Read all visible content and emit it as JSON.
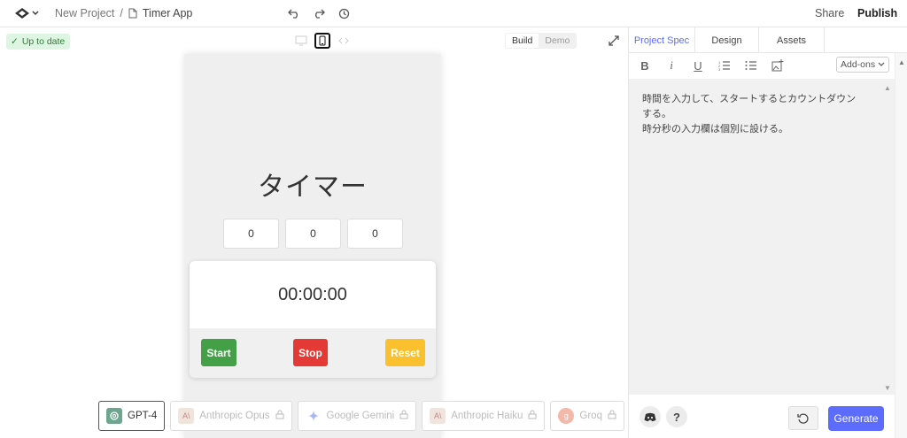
{
  "header": {
    "project_name": "New Project",
    "separator": "/",
    "file_name": "Timer App",
    "share_label": "Share",
    "publish_label": "Publish"
  },
  "canvas": {
    "status_label": "Up to date",
    "modes": [
      "Build",
      "Demo"
    ],
    "active_mode": "Build"
  },
  "preview": {
    "title": "タイマー",
    "inputs": [
      "0",
      "0",
      "0"
    ],
    "time_display": "00:00:00",
    "buttons": {
      "start": "Start",
      "stop": "Stop",
      "reset": "Reset"
    },
    "colors": {
      "start": "#43a047",
      "stop": "#e53935",
      "reset": "#fbc02d"
    }
  },
  "models": [
    {
      "label": "GPT-4",
      "icon": "openai-icon",
      "selected": true,
      "locked": false
    },
    {
      "label": "Anthropic Opus",
      "icon": "anthropic-icon",
      "selected": false,
      "locked": true
    },
    {
      "label": "Google Gemini",
      "icon": "gemini-icon",
      "selected": false,
      "locked": true
    },
    {
      "label": "Anthropic Haiku",
      "icon": "anthropic-icon",
      "selected": false,
      "locked": true
    },
    {
      "label": "Groq",
      "icon": "groq-icon",
      "selected": false,
      "locked": true
    }
  ],
  "panel": {
    "tabs": [
      "Project Spec",
      "Design",
      "Assets"
    ],
    "active_tab": "Project Spec",
    "addons_label": "Add-ons",
    "spec_lines": [
      "時間を入力して、スタートするとカウントダウン",
      "する。",
      "時分秒の入力欄は個別に設ける。"
    ],
    "help_label": "?",
    "generate_label": "Generate",
    "accent_color": "#5b6cff"
  }
}
